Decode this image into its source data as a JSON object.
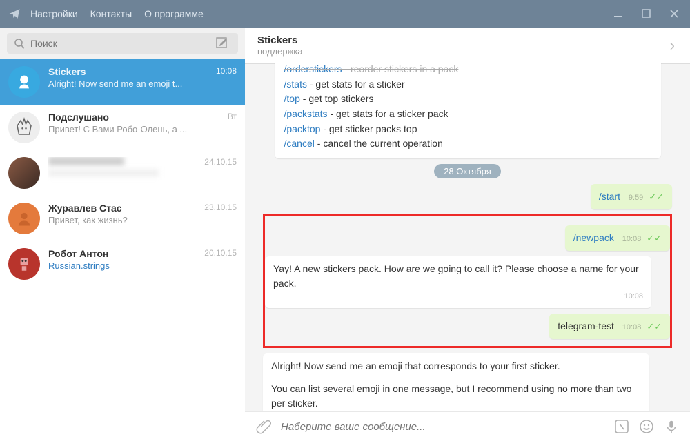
{
  "titlebar": {
    "menu": [
      "Настройки",
      "Контакты",
      "О программе"
    ]
  },
  "search": {
    "placeholder": "Поиск"
  },
  "chats": [
    {
      "name": "Stickers",
      "preview": "Alright! Now send me an emoji t...",
      "time": "10:08"
    },
    {
      "name": "Подслушано",
      "preview": "Привет! С Вами Робо-Олень, а ...",
      "time": "Вт"
    },
    {
      "name": "",
      "preview": "",
      "time": "24.10.15"
    },
    {
      "name": "Журавлев Стас",
      "preview": "Привет, как жизнь?",
      "time": "23.10.15"
    },
    {
      "name": "Робот Антон",
      "preview": "Russian.strings",
      "time": "20.10.15"
    }
  ],
  "header": {
    "title": "Stickers",
    "sub": "поддержка"
  },
  "date_chip": "28 Октября",
  "commands": {
    "cut": {
      "cmd": "/orderstickers",
      "desc": "reorder stickers in a pack"
    },
    "list": [
      {
        "cmd": "/stats",
        "desc": "get stats for a sticker"
      },
      {
        "cmd": "/top",
        "desc": "get top stickers"
      },
      {
        "cmd": "/packstats",
        "desc": "get stats for a sticker pack"
      },
      {
        "cmd": "/packtop",
        "desc": "get sticker packs top"
      },
      {
        "cmd": "/cancel",
        "desc": "cancel the current operation"
      }
    ]
  },
  "msgs": {
    "start": {
      "text": "/start",
      "time": "9:59"
    },
    "newpack": {
      "text": "/newpack",
      "time": "10:08"
    },
    "yay": {
      "text": "Yay! A new stickers pack. How are we going to call it? Please choose a name for your pack.",
      "time": "10:08"
    },
    "tg": {
      "text": "telegram-test",
      "time": "10:08"
    },
    "alright": {
      "line1": "Alright! Now send me an emoji that corresponds to your first sticker.",
      "line2": "You can list several emoji in one message, but I recommend using no more than two per sticker."
    }
  },
  "composer": {
    "placeholder": "Наберите ваше сообщение..."
  }
}
